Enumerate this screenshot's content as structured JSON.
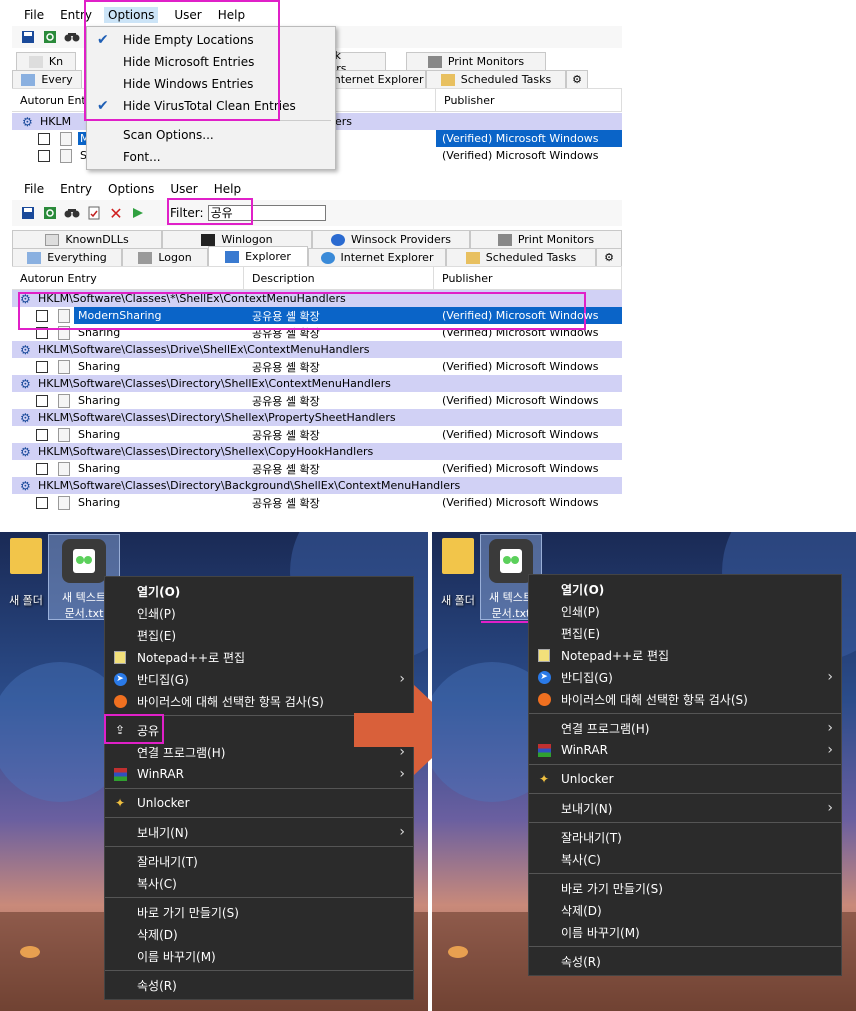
{
  "top_window": {
    "menu": [
      "File",
      "Entry",
      "Options",
      "User",
      "Help"
    ],
    "tabs_row1": [
      "Kn",
      "Winsock Providers",
      "Print Monitors"
    ],
    "tabs_row2": [
      "Every",
      "Internet Explorer",
      "Scheduled Tasks"
    ],
    "col_autorun": "Autorun Entry",
    "col_publisher": "Publisher",
    "group_path": "HKLM",
    "group_tail": "dlers",
    "row1_name": "M",
    "row1_pub": "(Verified) Microsoft Windows",
    "row2_name": "S",
    "row2_pub": "(Verified) Microsoft Windows",
    "options_menu": [
      {
        "label": "Hide Empty Locations",
        "checked": true
      },
      {
        "label": "Hide Microsoft Entries",
        "checked": false
      },
      {
        "label": "Hide Windows Entries",
        "checked": false
      },
      {
        "label": "Hide VirusTotal Clean Entries",
        "checked": true
      },
      {
        "label": "Scan Options...",
        "checked": false
      },
      {
        "label": "Font...",
        "checked": false
      }
    ]
  },
  "mid_window": {
    "menu": [
      "File",
      "Entry",
      "Options",
      "User",
      "Help"
    ],
    "filter_label": "Filter:",
    "filter_value": "공유",
    "tabs_row1": [
      "KnownDLLs",
      "Winlogon",
      "Winsock Providers",
      "Print Monitors"
    ],
    "tabs_row2": [
      "Everything",
      "Logon",
      "Explorer",
      "Internet Explorer",
      "Scheduled Tasks"
    ],
    "col_autorun": "Autorun Entry",
    "col_description": "Description",
    "col_publisher": "Publisher",
    "rows": [
      {
        "type": "group",
        "text": "HKLM\\Software\\Classes\\*\\ShellEx\\ContextMenuHandlers"
      },
      {
        "type": "item",
        "name": "ModernSharing",
        "desc": "공유용 셸 확장",
        "pub": "(Verified) Microsoft Windows",
        "selected": true
      },
      {
        "type": "item",
        "name": "Sharing",
        "desc": "공유용 셸 확장",
        "pub": "(Verified) Microsoft Windows"
      },
      {
        "type": "group",
        "text": "HKLM\\Software\\Classes\\Drive\\ShellEx\\ContextMenuHandlers"
      },
      {
        "type": "item",
        "name": "Sharing",
        "desc": "공유용 셸 확장",
        "pub": "(Verified) Microsoft Windows"
      },
      {
        "type": "group",
        "text": "HKLM\\Software\\Classes\\Directory\\ShellEx\\ContextMenuHandlers"
      },
      {
        "type": "item",
        "name": "Sharing",
        "desc": "공유용 셸 확장",
        "pub": "(Verified) Microsoft Windows"
      },
      {
        "type": "group",
        "text": "HKLM\\Software\\Classes\\Directory\\Shellex\\PropertySheetHandlers"
      },
      {
        "type": "item",
        "name": "Sharing",
        "desc": "공유용 셸 확장",
        "pub": "(Verified) Microsoft Windows"
      },
      {
        "type": "group",
        "text": "HKLM\\Software\\Classes\\Directory\\Shellex\\CopyHookHandlers"
      },
      {
        "type": "item",
        "name": "Sharing",
        "desc": "공유용 셸 확장",
        "pub": "(Verified) Microsoft Windows"
      },
      {
        "type": "group",
        "text": "HKLM\\Software\\Classes\\Directory\\Background\\ShellEx\\ContextMenuHandlers"
      },
      {
        "type": "item",
        "name": "Sharing",
        "desc": "공유용 셸 확장",
        "pub": "(Verified) Microsoft Windows"
      }
    ]
  },
  "desktop": {
    "folder_label": "새 폴더",
    "file_label_line1": "새 텍스트",
    "file_label_line2": "문서.txt",
    "menu_before": [
      {
        "label": "열기(O)",
        "bold": true
      },
      {
        "label": "인쇄(P)"
      },
      {
        "label": "편집(E)"
      },
      {
        "label": "Notepad++로 편집",
        "icon": "notepad-icon"
      },
      {
        "label": "반디집(G)",
        "icon": "bandizip-icon",
        "arrow": true
      },
      {
        "label": "바이러스에 대해 선택한 항목 검사(S)",
        "icon": "avast-icon"
      },
      {
        "sep": true
      },
      {
        "label": "공유",
        "icon": "share-icon",
        "highlight": true
      },
      {
        "label": "연결 프로그램(H)",
        "arrow": true
      },
      {
        "label": "WinRAR",
        "icon": "winrar-icon",
        "arrow": true
      },
      {
        "sep": true
      },
      {
        "label": "Unlocker",
        "icon": "unlocker-icon"
      },
      {
        "sep": true
      },
      {
        "label": "보내기(N)",
        "arrow": true
      },
      {
        "sep": true
      },
      {
        "label": "잘라내기(T)"
      },
      {
        "label": "복사(C)"
      },
      {
        "sep": true
      },
      {
        "label": "바로 가기 만들기(S)"
      },
      {
        "label": "삭제(D)"
      },
      {
        "label": "이름 바꾸기(M)"
      },
      {
        "sep": true
      },
      {
        "label": "속성(R)"
      }
    ],
    "menu_after": [
      {
        "label": "열기(O)",
        "bold": true
      },
      {
        "label": "인쇄(P)"
      },
      {
        "label": "편집(E)"
      },
      {
        "label": "Notepad++로 편집",
        "icon": "notepad-icon"
      },
      {
        "label": "반디집(G)",
        "icon": "bandizip-icon",
        "arrow": true
      },
      {
        "label": "바이러스에 대해 선택한 항목 검사(S)",
        "icon": "avast-icon"
      },
      {
        "sep": true
      },
      {
        "label": "연결 프로그램(H)",
        "arrow": true
      },
      {
        "label": "WinRAR",
        "icon": "winrar-icon",
        "arrow": true
      },
      {
        "sep": true
      },
      {
        "label": "Unlocker",
        "icon": "unlocker-icon"
      },
      {
        "sep": true
      },
      {
        "label": "보내기(N)",
        "arrow": true
      },
      {
        "sep": true
      },
      {
        "label": "잘라내기(T)"
      },
      {
        "label": "복사(C)"
      },
      {
        "sep": true
      },
      {
        "label": "바로 가기 만들기(S)"
      },
      {
        "label": "삭제(D)"
      },
      {
        "label": "이름 바꾸기(M)"
      },
      {
        "sep": true
      },
      {
        "label": "속성(R)"
      }
    ]
  },
  "colors": {
    "highlight": "#e020c8",
    "selection": "#0a64c8",
    "group_row": "#d1d1f5",
    "menu_bg": "#2b2b2b",
    "arrow": "#d9603a"
  }
}
